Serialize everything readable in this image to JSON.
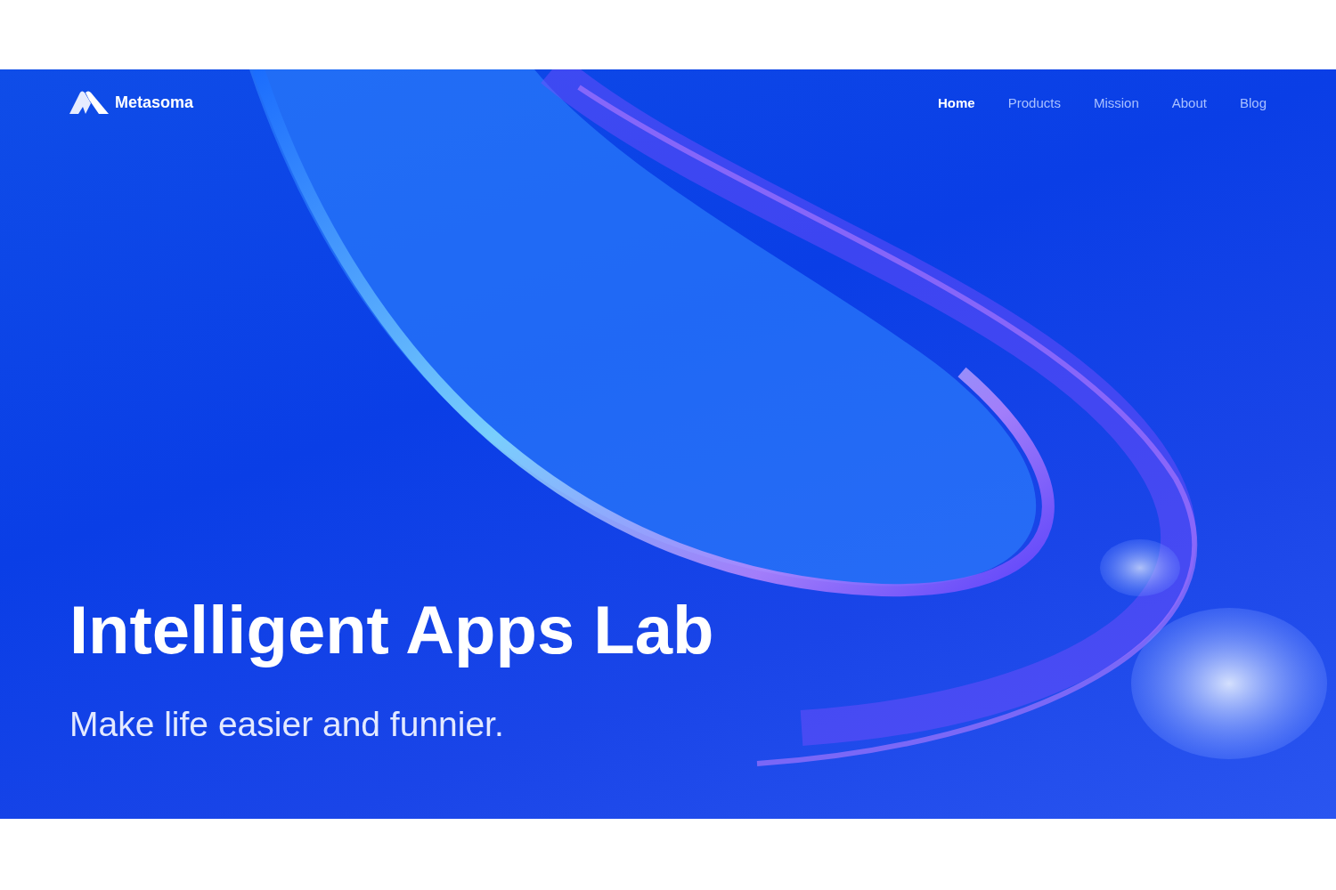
{
  "header": {
    "brand": "Metasoma",
    "nav": [
      {
        "label": "Home",
        "selected": true
      },
      {
        "label": "Products",
        "selected": false
      },
      {
        "label": "Mission",
        "selected": false
      },
      {
        "label": "About",
        "selected": false
      },
      {
        "label": "Blog",
        "selected": false
      }
    ]
  },
  "hero": {
    "title": "Intelligent Apps Lab",
    "subtitle": "Make life easier and funnier."
  }
}
